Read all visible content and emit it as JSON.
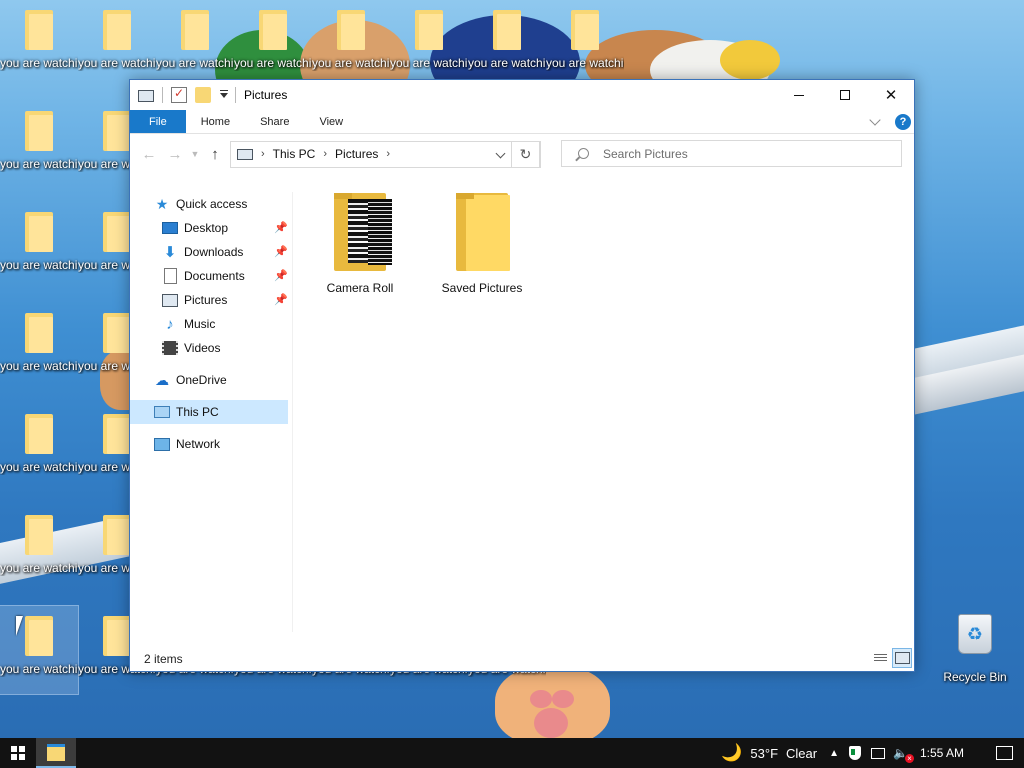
{
  "desktop": {
    "icons": [
      {
        "label": "you are watching pa..."
      },
      {
        "label": "you are watching pa..."
      },
      {
        "label": "you are watching pa..."
      },
      {
        "label": "you are watching pa..."
      },
      {
        "label": "you are watching pa..."
      },
      {
        "label": "you are watching pa..."
      },
      {
        "label": "you are watching pa..."
      },
      {
        "label": "you are watching pa..."
      },
      {
        "label": "you are watching pa..."
      },
      {
        "label": "you are watching pa..."
      },
      {
        "label": "you are watching pa..."
      },
      {
        "label": "you are watching pa..."
      },
      {
        "label": "you are watching pa..."
      },
      {
        "label": "you are watching pa..."
      },
      {
        "label": "you are watching pa..."
      },
      {
        "label": "you are watching pa..."
      },
      {
        "label": "you are watching pa..."
      },
      {
        "label": "you are watching pa..."
      },
      {
        "label": "you are watching pa..."
      },
      {
        "label": "you are watching pa..."
      },
      {
        "label": "you are watching pa..."
      }
    ],
    "recycle_bin": {
      "label": "Recycle Bin"
    }
  },
  "window": {
    "title": "Pictures",
    "ribbon_tabs": [
      "File",
      "Home",
      "Share",
      "View"
    ],
    "help_label": "?",
    "breadcrumb": [
      "This PC",
      "Pictures"
    ],
    "search_placeholder": "Search Pictures",
    "nav_pane": {
      "quick_access": "Quick access",
      "pinned": [
        "Desktop",
        "Downloads",
        "Documents",
        "Pictures"
      ],
      "unpinned": [
        "Music",
        "Videos"
      ],
      "onedrive": "OneDrive",
      "this_pc": "This PC",
      "network": "Network"
    },
    "items": [
      {
        "name": "Camera Roll",
        "icon": "folder-with-thumbnails-icon"
      },
      {
        "name": "Saved Pictures",
        "icon": "folder-icon"
      }
    ],
    "status": "2 items",
    "accent_color": "#1979ca"
  },
  "taskbar": {
    "weather_temp": "53°F",
    "weather_condition": "Clear",
    "clock": "1:55 AM"
  }
}
